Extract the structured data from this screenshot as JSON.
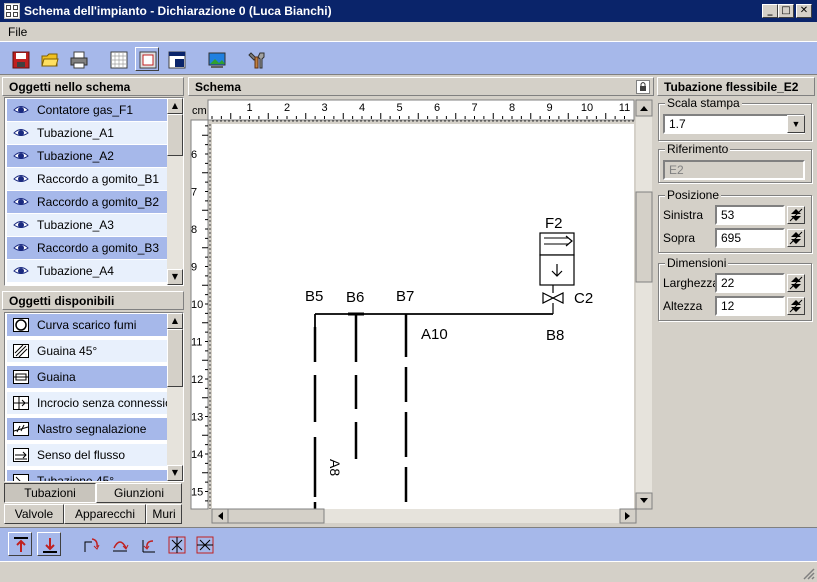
{
  "window": {
    "title": "Schema dell'impianto - Dichiarazione 0 (Luca Bianchi)",
    "minimize": "_",
    "maximize": "□",
    "close": "✕"
  },
  "menu": {
    "file": "File"
  },
  "toolbar": {
    "buttons": [
      "save-icon",
      "open-folder-icon",
      "print-icon",
      "grid-view-icon",
      "page-view-icon",
      "window-view-icon",
      "picture-icon",
      "settings-tools-icon"
    ]
  },
  "objects_panel": {
    "title": "Oggetti nello schema",
    "items": [
      "Contatore gas_F1",
      "Tubazione_A1",
      "Tubazione_A2",
      "Raccordo a gomito_B1",
      "Raccordo a gomito_B2",
      "Tubazione_A3",
      "Raccordo a gomito_B3",
      "Tubazione_A4"
    ]
  },
  "available_panel": {
    "title": "Oggetti disponibili",
    "items": [
      "Curva scarico fumi",
      "Guaina 45°",
      "Guaina",
      "Incrocio senza connession",
      "Nastro segnalazione",
      "Senso del flusso",
      "Tubazione 45°"
    ],
    "tabs_row1": [
      "Tubazioni",
      "Giunzioni"
    ],
    "tabs_row2": [
      "Valvole",
      "Apparecchi",
      "Muri"
    ]
  },
  "schema": {
    "title": "Schema",
    "unit": "cm",
    "ruler_top": [
      "1",
      "2",
      "3",
      "4",
      "5",
      "6",
      "7",
      "8",
      "9",
      "10",
      "11"
    ],
    "ruler_left": [
      "6",
      "7",
      "8",
      "9",
      "10",
      "11",
      "12",
      "13",
      "14",
      "15"
    ],
    "labels": {
      "f2": "F2",
      "b5": "B5",
      "b6": "B6",
      "b7": "B7",
      "c2": "C2",
      "a10": "A10",
      "b8": "B8",
      "a8": "A8"
    }
  },
  "properties": {
    "title": "Tubazione flessibile_E2",
    "scala_label": "Scala stampa",
    "scala_value": "1.7",
    "riferimento_label": "Riferimento",
    "riferimento_value": "E2",
    "posizione_label": "Posizione",
    "sinistra_label": "Sinistra",
    "sinistra_value": "53",
    "sopra_label": "Sopra",
    "sopra_value": "695",
    "dimensioni_label": "Dimensioni",
    "larghezza_label": "Larghezza",
    "larghezza_value": "22",
    "altezza_label": "Altezza",
    "altezza_value": "12"
  },
  "bottom_toolbar": {
    "buttons": [
      "bring-to-front-icon",
      "send-to-back-icon",
      "rotate-right-icon",
      "rotate-180-icon",
      "rotate-left-icon",
      "flip-horizontal-icon",
      "flip-vertical-icon"
    ]
  },
  "colors": {
    "accent": "#a6b8ea",
    "titlebar": "#0a246a",
    "light_row": "#e8f0fc"
  }
}
